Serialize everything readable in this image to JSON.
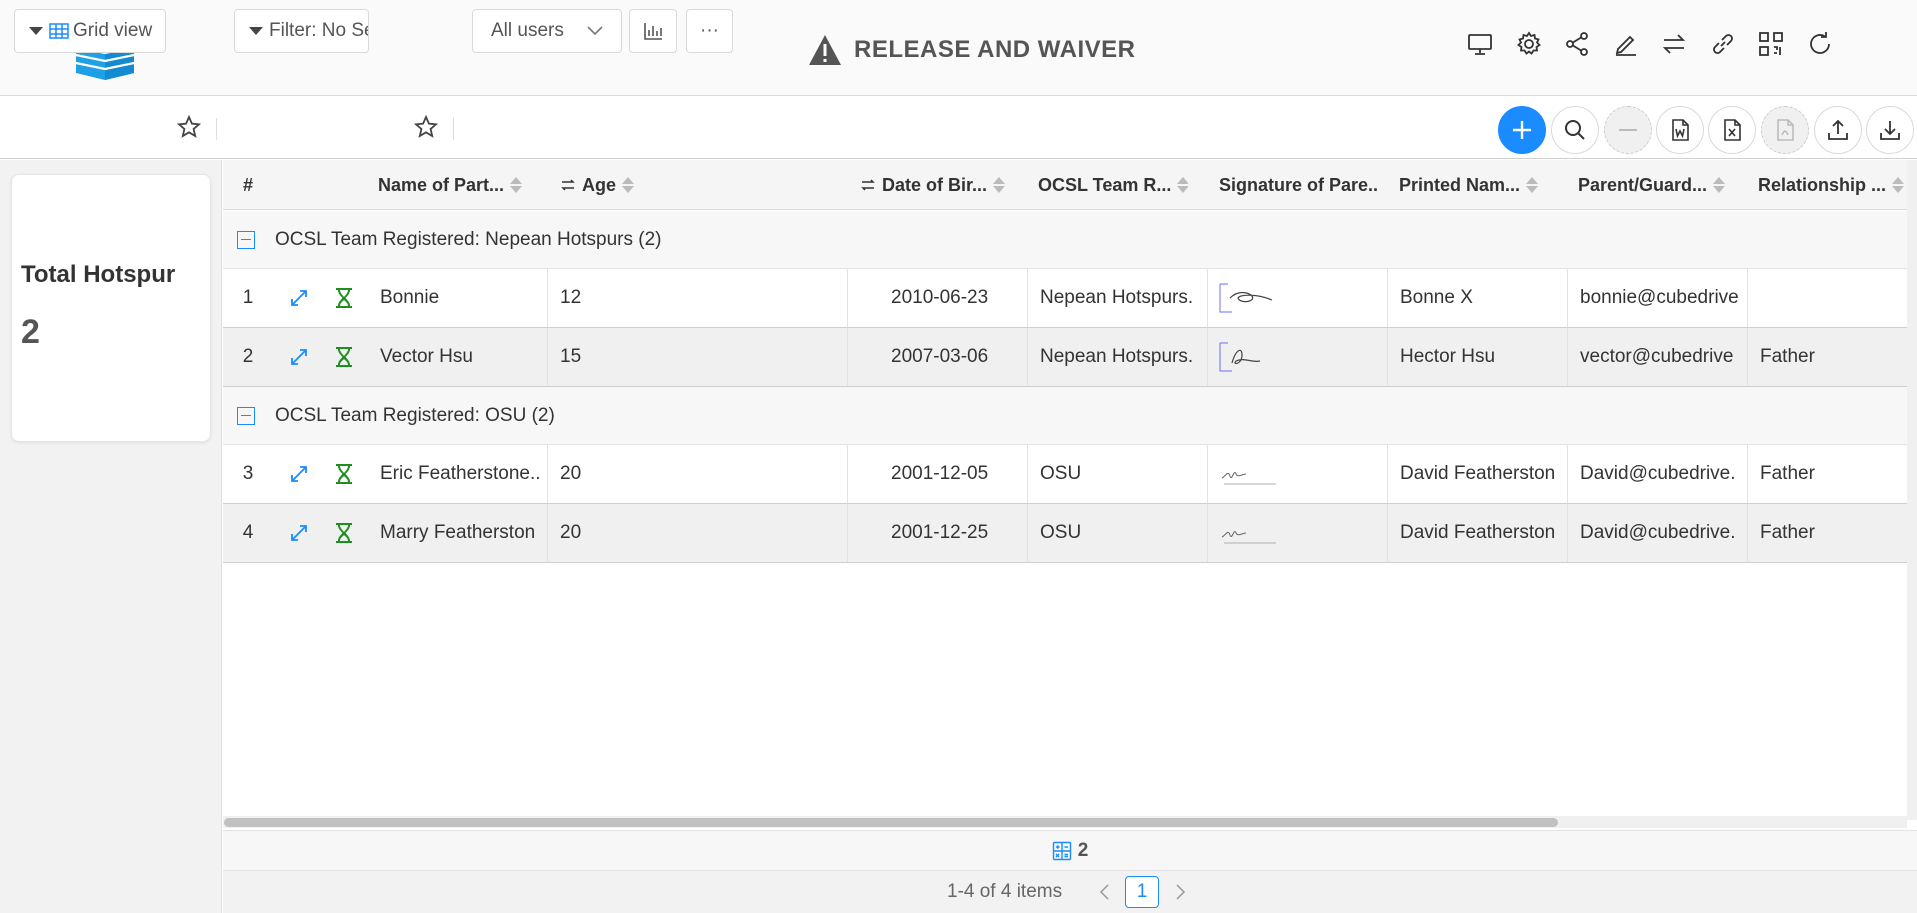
{
  "header": {
    "title": "RELEASE AND WAIVER",
    "icons": [
      "monitor-icon",
      "gear-icon",
      "share-icon",
      "edit-icon",
      "swap-icon",
      "link-icon",
      "qr-icon",
      "refresh-icon"
    ]
  },
  "toolbar": {
    "view_label": "Grid view",
    "filter_label": "Filter: No Setti",
    "users_label": "All users",
    "more_label": "···"
  },
  "summary": {
    "label": "Total Hotspur",
    "value": "2"
  },
  "grid": {
    "columns": [
      "#",
      "Name of Part...",
      "Age",
      "Date of Bir...",
      "OCSL Team R...",
      "Signature of Pare...",
      "Printed Nam...",
      "Parent/Guard...",
      "Relationship ..."
    ],
    "groups": [
      {
        "label": "OCSL Team Registered: Nepean Hotspurs (2)",
        "rows": [
          {
            "num": "1",
            "name": "Bonnie",
            "age": "12",
            "dob": "2010-06-23",
            "team": "Nepean Hotspurs.",
            "printed": "Bonne X",
            "email": "bonnie@cubedrive",
            "relationship": ""
          },
          {
            "num": "2",
            "name": "Vector Hsu",
            "age": "15",
            "dob": "2007-03-06",
            "team": "Nepean Hotspurs.",
            "printed": "Hector Hsu",
            "email": "vector@cubedrive",
            "relationship": "Father"
          }
        ]
      },
      {
        "label": "OCSL Team Registered: OSU (2)",
        "rows": [
          {
            "num": "3",
            "name": "Eric Featherstone..",
            "age": "20",
            "dob": "2001-12-05",
            "team": "OSU",
            "printed": "David Featherston",
            "email": "David@cubedrive.",
            "relationship": "Father"
          },
          {
            "num": "4",
            "name": "Marry Featherston",
            "age": "20",
            "dob": "2001-12-25",
            "team": "OSU",
            "printed": "David Featherston",
            "email": "David@cubedrive.",
            "relationship": "Father"
          }
        ]
      }
    ]
  },
  "footer": {
    "summary_count": "2",
    "page_info": "1-4 of 4 items",
    "current_page": "1"
  },
  "colors": {
    "accent": "#1a8cff",
    "hourglass": "#1e8f1e",
    "logo": "#1ea0e6"
  }
}
